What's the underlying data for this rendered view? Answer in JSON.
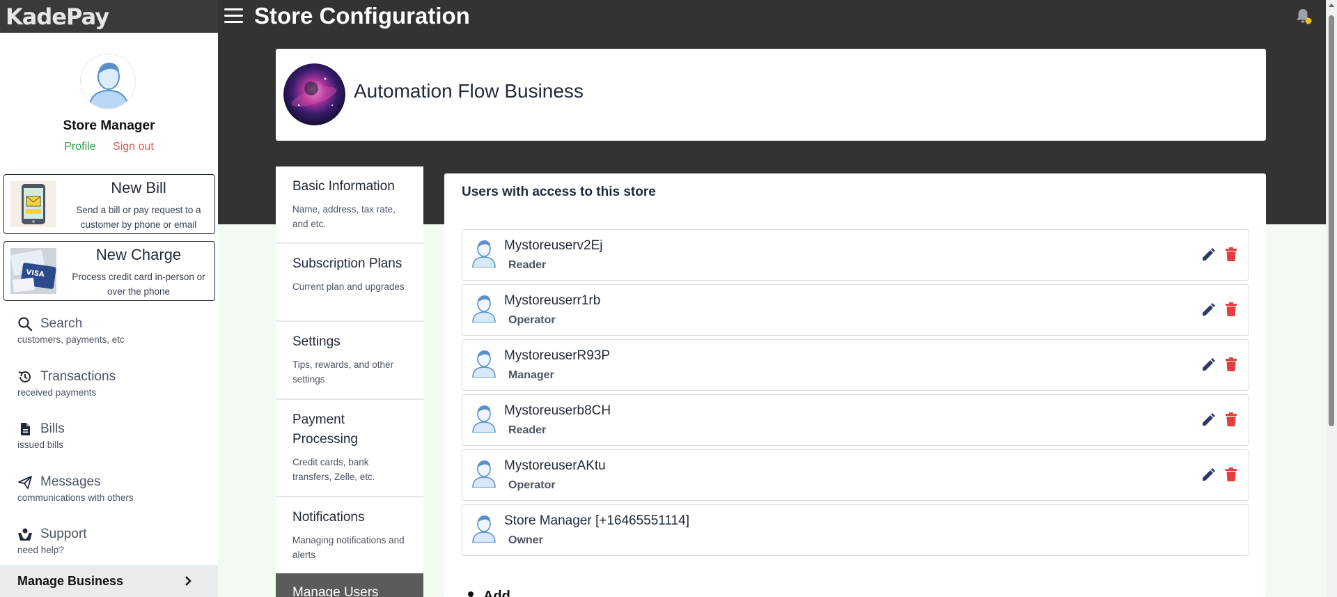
{
  "app": {
    "brand": "KadePay",
    "page_title": "Store Configuration"
  },
  "colors": {
    "topbar": "#333333",
    "accent_green": "#2e9e4f",
    "danger_red": "#e53e3e",
    "edit_blue": "#2d3a66",
    "bell_badge": "#f0c20c"
  },
  "sidebar": {
    "user": {
      "name": "Store Manager",
      "profile_label": "Profile",
      "signout_label": "Sign out"
    },
    "actions": [
      {
        "title": "New Bill",
        "subtitle": "Send a bill or pay request to a customer by phone or email",
        "icon": "phone-bill-icon"
      },
      {
        "title": "New Charge",
        "subtitle": "Process credit card in-person or over the phone",
        "icon": "credit-cards-icon"
      }
    ],
    "nav": [
      {
        "label": "Search",
        "sub": "customers, payments, etc",
        "icon": "search-icon"
      },
      {
        "label": "Transactions",
        "sub": "received payments",
        "icon": "history-icon"
      },
      {
        "label": "Bills",
        "sub": "issued bills",
        "icon": "document-icon"
      },
      {
        "label": "Messages",
        "sub": "communications with others",
        "icon": "paper-plane-icon"
      },
      {
        "label": "Support",
        "sub": "need help?",
        "icon": "support-hands-icon"
      }
    ],
    "manage_business": "Manage Business"
  },
  "business": {
    "name": "Automation Flow Business"
  },
  "settings_menu": [
    {
      "title": "Basic Information",
      "sub": "Name, address, tax rate, and etc."
    },
    {
      "title": "Subscription Plans",
      "sub": "Current plan and upgrades"
    },
    {
      "title": "Settings",
      "sub": "Tips, rewards, and other settings"
    },
    {
      "title": "Payment Processing",
      "sub": "Credit cards, bank transfers, Zelle, etc."
    },
    {
      "title": "Notifications",
      "sub": "Managing notifications and alerts"
    },
    {
      "title": "Manage Users",
      "sub": ""
    }
  ],
  "users_panel": {
    "heading": "Users with access to this store",
    "users": [
      {
        "name": "Mystoreuserv2Ej",
        "role": "Reader"
      },
      {
        "name": "Mystoreuserr1rb",
        "role": "Operator"
      },
      {
        "name": "MystoreuserR93P",
        "role": "Manager"
      },
      {
        "name": "Mystoreuserb8CH",
        "role": "Reader"
      },
      {
        "name": "MystoreuserAKtu",
        "role": "Operator"
      },
      {
        "name": "Store Manager [+16465551114]",
        "role": "Owner"
      }
    ],
    "add_label": "Add"
  }
}
